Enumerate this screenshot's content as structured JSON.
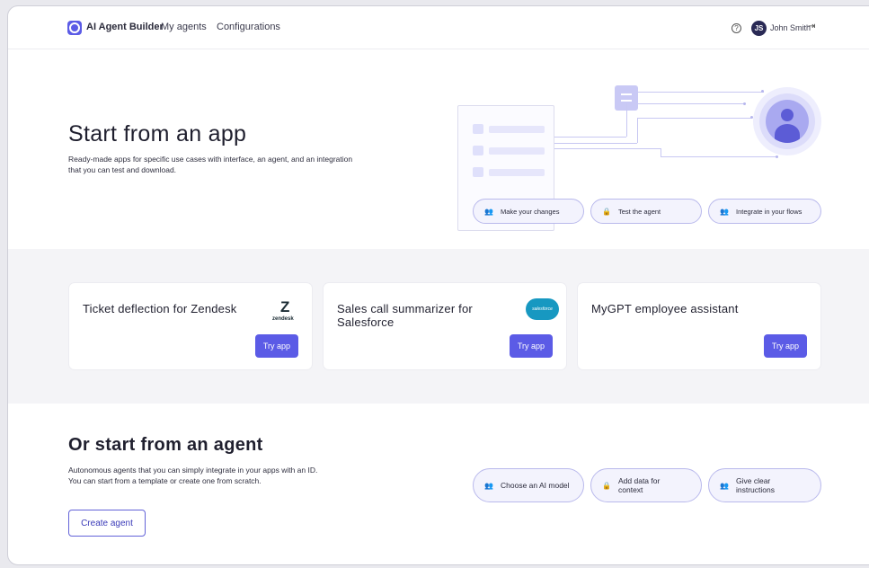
{
  "nav": {
    "brand": "AI Agent Builder",
    "links": [
      "My agents",
      "Configurations"
    ],
    "help_icon": "?",
    "user_initials": "JS",
    "user_name": "John Smith",
    "logout_icon": "⇥"
  },
  "hero": {
    "title": "Start from an app",
    "subtitle": "Ready-made apps for specific use cases with interface, an agent, and an integration that you can test and download.",
    "steps": [
      "Make your changes",
      "Test the agent",
      "Integrate in your flows"
    ]
  },
  "apps": [
    {
      "title": "Ticket deflection for Zendesk",
      "logo": "zendesk",
      "button": "Try app"
    },
    {
      "title": "Sales call summarizer for Salesforce",
      "logo": "salesforce",
      "button": "Try app"
    },
    {
      "title": "MyGPT employee assistant",
      "logo": "",
      "button": "Try app"
    }
  ],
  "agent_section": {
    "title": "Or start from an agent",
    "subtitle_line1": "Autonomous agents that you can simply integrate in your apps with an ID.",
    "subtitle_line2": "You can start from a template or create one from scratch.",
    "create_button": "Create agent",
    "steps": [
      "Choose an AI model",
      "Add data for context",
      "Give clear instructions"
    ]
  },
  "colors": {
    "accent": "#5b5be6",
    "band": "#f4f4f7",
    "pill_bg": "#f3f3fd"
  }
}
